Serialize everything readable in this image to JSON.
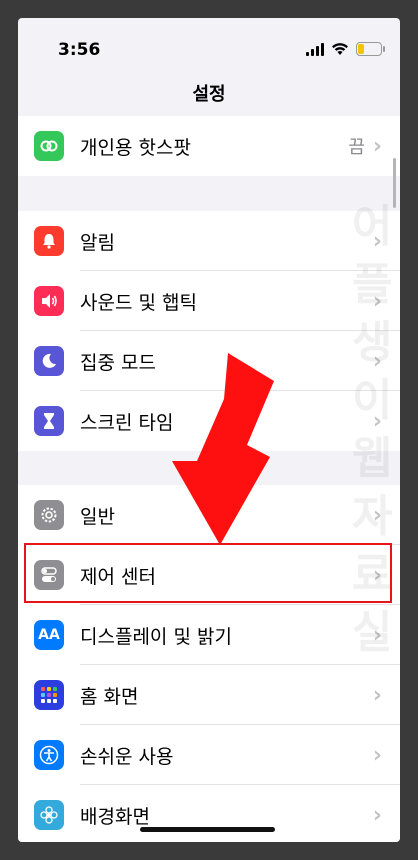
{
  "status_bar": {
    "time": "3:56"
  },
  "nav": {
    "title": "설정"
  },
  "hotspot": {
    "label": "개인용 핫스팟",
    "value": "끔"
  },
  "group2": [
    {
      "name": "notifications",
      "label": "알림",
      "icon": "bell-icon",
      "color": "#ff3b30"
    },
    {
      "name": "sounds",
      "label": "사운드 및 햅틱",
      "icon": "speaker-icon",
      "color": "#ff2d55"
    },
    {
      "name": "focus",
      "label": "집중 모드",
      "icon": "moon-icon",
      "color": "#5856d6"
    },
    {
      "name": "screen-time",
      "label": "스크린 타임",
      "icon": "hourglass-icon",
      "color": "#5856d6"
    }
  ],
  "group3": [
    {
      "name": "general",
      "label": "일반",
      "icon": "gear-icon",
      "color": "#8e8e93"
    },
    {
      "name": "control-center",
      "label": "제어 센터",
      "icon": "toggles-icon",
      "color": "#8e8e93"
    },
    {
      "name": "display",
      "label": "디스플레이 및 밝기",
      "icon": "aa-icon",
      "color": "#007aff",
      "icon_text": "AA"
    },
    {
      "name": "home-screen",
      "label": "홈 화면",
      "icon": "grid-icon",
      "color": "#2c3ee0"
    },
    {
      "name": "accessibility",
      "label": "손쉬운 사용",
      "icon": "accessibility-icon",
      "color": "#007aff"
    },
    {
      "name": "wallpaper",
      "label": "배경화면",
      "icon": "flower-icon",
      "color": "#34aadc"
    }
  ],
  "watermark": "어플생이웹자료실",
  "colors": {
    "highlight": "#e8141b",
    "arrow": "#ff1010"
  }
}
